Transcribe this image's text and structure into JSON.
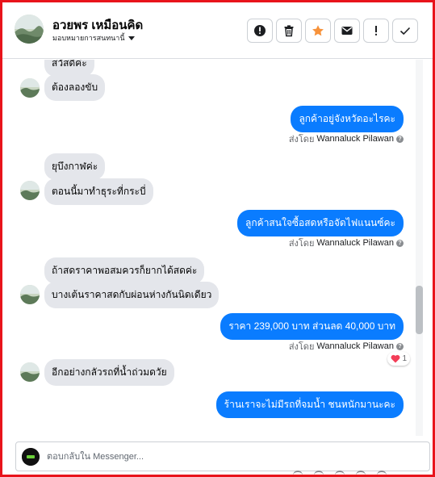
{
  "header": {
    "contact_name": "อวยพร เหมือนคิด",
    "assign_label": "มอบหมายการสนทนานี้",
    "actions": [
      {
        "name": "spam-button",
        "icon": "alert-circle-icon"
      },
      {
        "name": "delete-button",
        "icon": "trash-icon"
      },
      {
        "name": "star-button",
        "icon": "star-icon",
        "color": "#f7923a"
      },
      {
        "name": "email-button",
        "icon": "envelope-icon"
      },
      {
        "name": "follow-up-button",
        "icon": "exclamation-icon"
      },
      {
        "name": "done-button",
        "icon": "check-icon"
      }
    ]
  },
  "messages": {
    "m0": "สวัสดีค่ะ",
    "m1": "ต้องลองขับ",
    "m2": "ลูกค้าอยู่จังหวัดอะไรคะ",
    "m3": "ยุบึงกาฬค่ะ",
    "m4": "ตอนนี้มาทำธุระที่กระบี่",
    "m5": "ลูกค้าสนใจซื้อสดหรือจัดไฟแนนซ์คะ",
    "m6": "ถ้าสดราคาพอสมควรก็ยากได้สดค่ะ",
    "m7": "บางเต้นราคาสดกับผ่อนห่างกันนิดเดียว",
    "m8": "ราคา 239,000 บาท ส่วนลด  40,000 บาท",
    "m9": "อีกอย่างกลัวรถที่น้ำถ่วมดวัย",
    "m10": "ร้านเราจะไม่มีรถที่จมน้ำ ชนหนักมานะคะ"
  },
  "sent_by": {
    "prefix": "ส่งโดย",
    "agent": "Wannaluck Pilawan"
  },
  "reaction": {
    "emoji": "heart",
    "count": "1"
  },
  "composer": {
    "placeholder": "ตอบกลับใน Messenger..."
  },
  "colors": {
    "outgoing_bubble": "#0a7cff",
    "incoming_bubble": "#e4e6eb",
    "frame_border": "#e8141b",
    "star": "#f7923a"
  }
}
